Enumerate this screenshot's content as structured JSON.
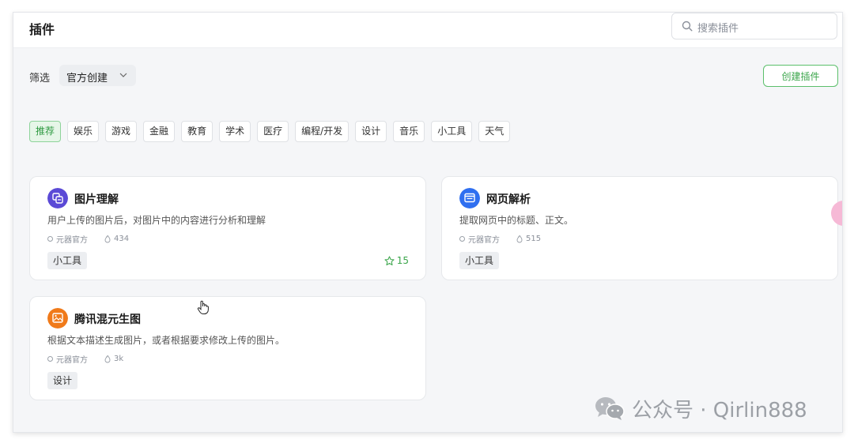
{
  "header": {
    "title": "插件",
    "search_placeholder": "搜索插件"
  },
  "filter": {
    "label": "筛选",
    "selected": "官方创建"
  },
  "create_button": "创建插件",
  "tabs": [
    {
      "label": "推荐",
      "active": true
    },
    {
      "label": "娱乐",
      "active": false
    },
    {
      "label": "游戏",
      "active": false
    },
    {
      "label": "金融",
      "active": false
    },
    {
      "label": "教育",
      "active": false
    },
    {
      "label": "学术",
      "active": false
    },
    {
      "label": "医疗",
      "active": false
    },
    {
      "label": "编程/开发",
      "active": false
    },
    {
      "label": "设计",
      "active": false
    },
    {
      "label": "音乐",
      "active": false
    },
    {
      "label": "小工具",
      "active": false
    },
    {
      "label": "天气",
      "active": false
    }
  ],
  "plugins": [
    {
      "title": "图片理解",
      "description": "用户上传的图片后，对图片中的内容进行分析和理解",
      "author": "元器官方",
      "uses": "434",
      "tag": "小工具",
      "stars": "15",
      "icon": "image-understanding-icon",
      "icon_color": "#5b4ad6"
    },
    {
      "title": "网页解析",
      "description": "提取网页中的标题、正文。",
      "author": "元器官方",
      "uses": "515",
      "tag": "小工具",
      "stars": "",
      "icon": "web-parse-icon",
      "icon_color": "#2f6ff0"
    },
    {
      "title": "腾讯混元生图",
      "description": "根据文本描述生成图片，或者根据要求修改上传的图片。",
      "author": "元器官方",
      "uses": "3k",
      "tag": "设计",
      "stars": "",
      "icon": "image-generation-icon",
      "icon_color": "#f07a1a"
    }
  ],
  "watermark": "公众号 · Qirlin888",
  "colors": {
    "accent_green": "#3aa54a",
    "active_tab_bg": "#e6f6e8"
  }
}
